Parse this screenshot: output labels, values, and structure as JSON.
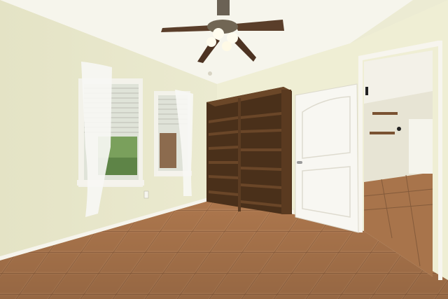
{
  "scene": {
    "description_free": true
  },
  "colors": {
    "wall_left": "#e9e8cd",
    "wall_back": "#f0efd6",
    "ceiling": "#f7f6ee",
    "floor": "#b98255",
    "floor_dark": "#9c6a45",
    "trim": "#f4f2ea",
    "shelf_wood": "#5b3c22",
    "shelf_dark": "#3c2614",
    "door": "#f7f6f1",
    "fan_blade": "#5a3e2a"
  }
}
